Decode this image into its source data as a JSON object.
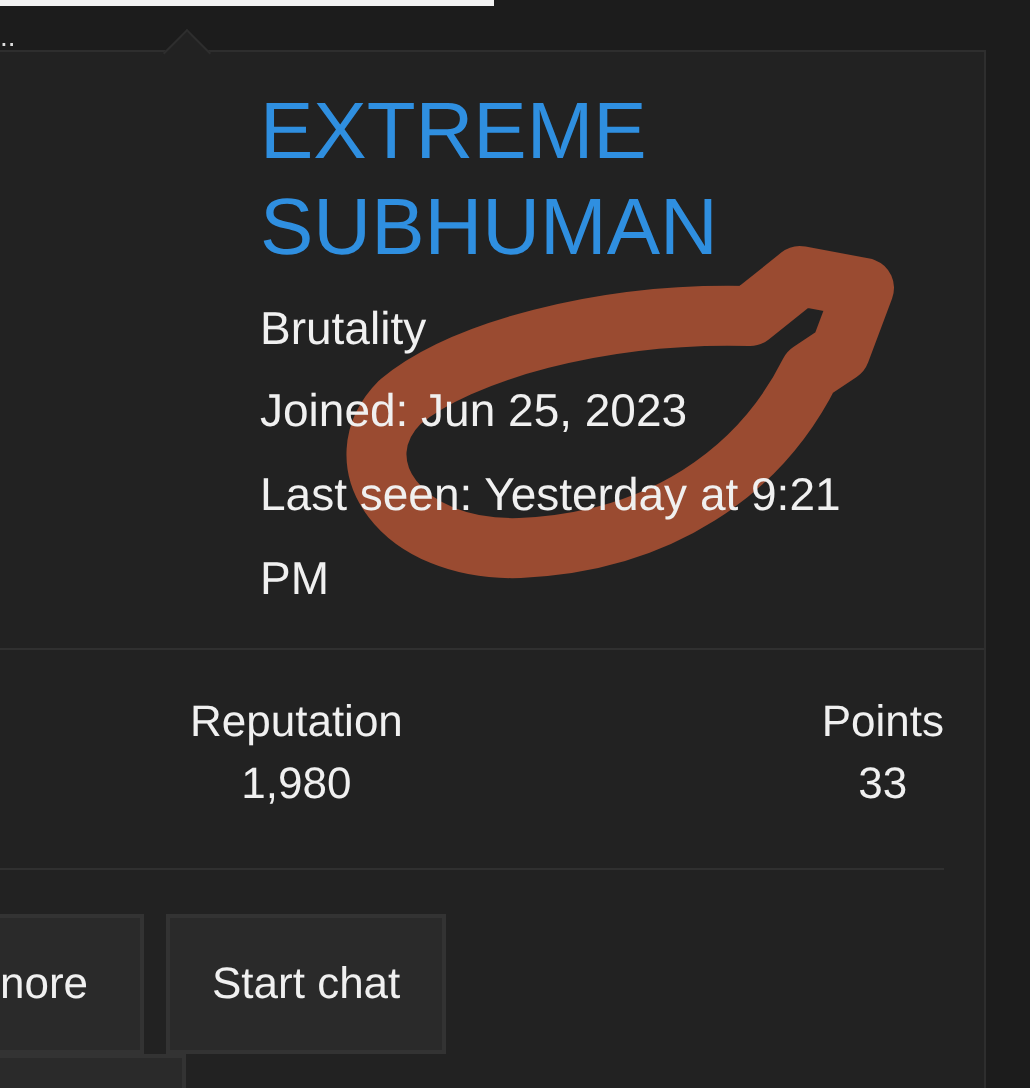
{
  "header": {
    "text": ".."
  },
  "profile": {
    "username": "EXTREME SUBHUMAN",
    "user_title": "Brutality",
    "joined": "Joined: Jun 25, 2023",
    "last_seen": "Last seen: Yesterday at 9:21 PM"
  },
  "stats": [
    {
      "label": "Reputation",
      "value": "1,980"
    },
    {
      "label": "Points",
      "value": "33"
    }
  ],
  "buttons": [
    {
      "label": "nore"
    },
    {
      "label": "Start chat"
    }
  ]
}
